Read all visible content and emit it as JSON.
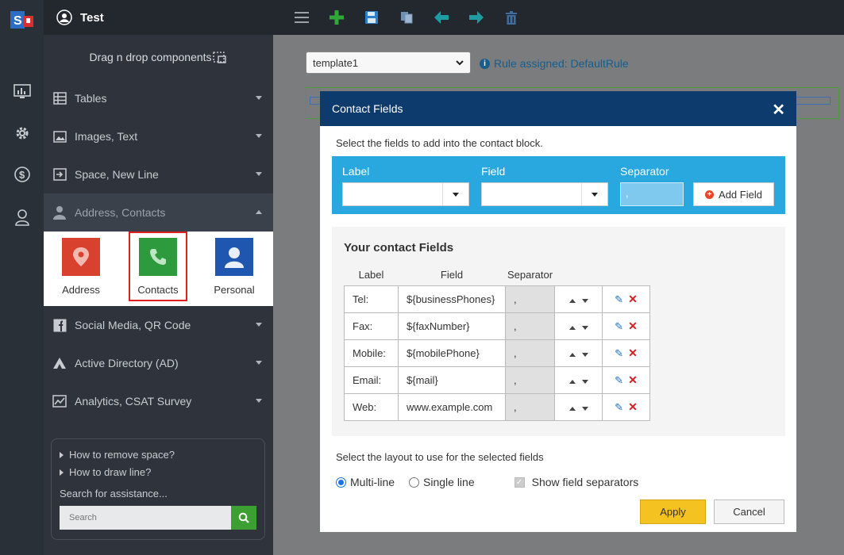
{
  "app": {
    "user_name": "Test"
  },
  "sidebar": {
    "dnd_label": "Drag n drop components",
    "items": [
      {
        "label": "Tables"
      },
      {
        "label": "Images, Text"
      },
      {
        "label": "Space, New Line"
      },
      {
        "label": "Address, Contacts"
      },
      {
        "label": "Social Media, QR Code"
      },
      {
        "label": "Active Directory (AD)"
      },
      {
        "label": "Analytics, CSAT Survey"
      }
    ],
    "components": [
      {
        "label": "Address",
        "color": "#d9412f"
      },
      {
        "label": "Contacts",
        "color": "#2e9a3e"
      },
      {
        "label": "Personal",
        "color": "#1f56b0"
      }
    ],
    "help": {
      "links": [
        "How to remove space?",
        "How to draw line?"
      ],
      "assist_label": "Search for assistance...",
      "search_placeholder": "Search"
    }
  },
  "template": {
    "selected": "template1",
    "rule_text": "Rule assigned: DefaultRule"
  },
  "modal": {
    "title": "Contact Fields",
    "intro": "Select the fields to add into the contact block.",
    "add": {
      "label_header": "Label",
      "field_header": "Field",
      "separator_header": "Separator",
      "separator_value": ",",
      "add_button": "Add Field"
    },
    "yours": {
      "title": "Your contact Fields",
      "headers": [
        "Label",
        "Field",
        "Separator"
      ],
      "rows": [
        {
          "label": "Tel:",
          "field": "${businessPhones}",
          "sep": ","
        },
        {
          "label": "Fax:",
          "field": "${faxNumber}",
          "sep": ","
        },
        {
          "label": "Mobile:",
          "field": "${mobilePhone}",
          "sep": ","
        },
        {
          "label": "Email:",
          "field": "${mail}",
          "sep": ","
        },
        {
          "label": "Web:",
          "field": "www.example.com",
          "sep": ","
        }
      ]
    },
    "layout": {
      "prompt": "Select the layout to use for the selected fields",
      "multi": "Multi-line",
      "single": "Single line",
      "separators": "Show field separators",
      "selected": "Multi-line"
    },
    "apply": "Apply",
    "cancel": "Cancel"
  },
  "colors": {
    "accent_blue": "#29a8e0",
    "header_navy": "#0d3b6e",
    "apply_yellow": "#f4c321"
  }
}
